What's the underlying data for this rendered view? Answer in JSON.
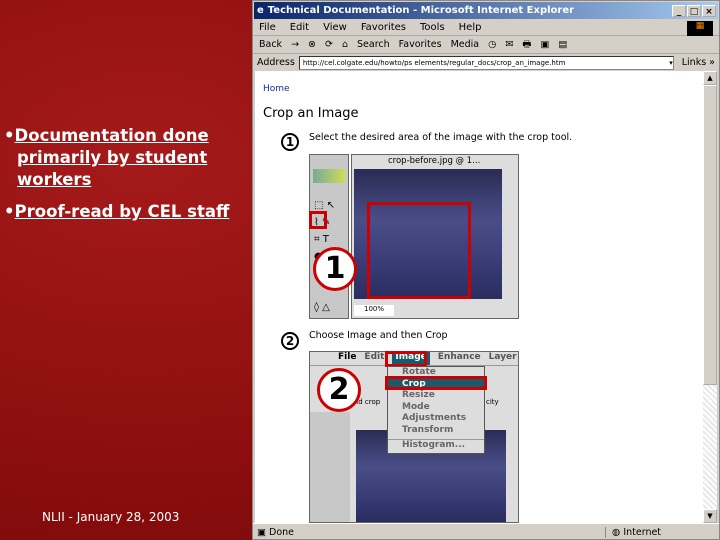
{
  "slide": {
    "bullets": [
      "Documentation done primarily by student workers",
      "Proof-read by CEL staff"
    ],
    "footer": "NLII -  January 28, 2003"
  },
  "browser": {
    "title": "Technical Documentation - Microsoft Internet Explorer",
    "menu": [
      "File",
      "Edit",
      "View",
      "Favorites",
      "Tools",
      "Help"
    ],
    "toolbar": [
      "Back",
      "→",
      "⊗",
      "⟳",
      "⌂",
      "Search",
      "Favorites",
      "Media",
      "◷",
      "✉",
      "🖶",
      "▣",
      "▤"
    ],
    "address_label": "Address",
    "address_url": "http://cel.colgate.edu/howto/ps elements/regular_docs/crop_an_image.htm",
    "links": "Links »",
    "status": "Done",
    "zone": "Internet"
  },
  "page": {
    "home_link": "Home",
    "title": "Crop an Image",
    "step1": {
      "num": "1",
      "text": "Select the desired area of the image with the crop tool.",
      "window_title": "crop-before.jpg @ 1...",
      "zoom": "100%",
      "callout": "1"
    },
    "step2": {
      "num": "2",
      "text": "Choose Image and then Crop",
      "menubar": [
        "File",
        "Edit",
        "Image",
        "Enhance",
        "Layer"
      ],
      "menu_items": [
        "Rotate",
        "Crop",
        "Resize",
        "Mode",
        "Adjustments",
        "Transform",
        "Histogram..."
      ],
      "selected": "Crop",
      "callout": "2",
      "options_text": "eld crop",
      "opacity_label": "city"
    }
  },
  "colors": {
    "accent": "#cc0000",
    "slide_bg": "#8a0d0d",
    "titlebar": "#0a246a",
    "menu_highlight": "#1a5a6a"
  }
}
